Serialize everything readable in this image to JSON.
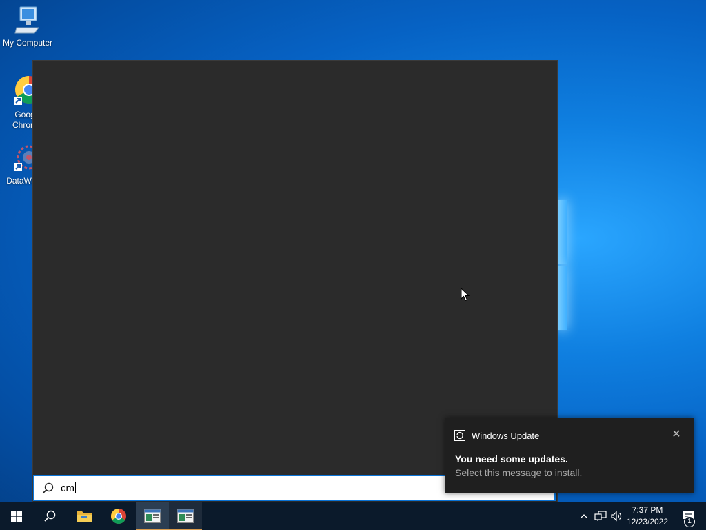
{
  "desktop": {
    "icons": [
      {
        "label": "My Computer",
        "icon": "computer-icon"
      },
      {
        "label": "Goog\nChrom",
        "label_line1": "Goog",
        "label_line2": "Chrom",
        "icon": "chrome-icon"
      },
      {
        "label_line1": "DataWag",
        "icon": "datawag-icon"
      }
    ]
  },
  "search": {
    "query": "cm",
    "icon": "search-icon"
  },
  "toast": {
    "app_name": "Windows Update",
    "title": "You need some updates.",
    "body": "Select this message to install.",
    "close_glyph": "✕"
  },
  "taskbar": {
    "items": [
      {
        "name": "start",
        "icon": "windows-start-icon"
      },
      {
        "name": "search",
        "icon": "search-icon"
      },
      {
        "name": "file-explorer",
        "icon": "folder-icon"
      },
      {
        "name": "chrome",
        "icon": "chrome-icon"
      },
      {
        "name": "app-1",
        "icon": "app-window-icon",
        "state": "active"
      },
      {
        "name": "app-2",
        "icon": "app-window-icon",
        "state": "running"
      }
    ],
    "tray": {
      "chevron": "^",
      "time": "7:37 PM",
      "date": "12/23/2022",
      "notification_count": "1"
    }
  },
  "colors": {
    "accent": "#0a74d8",
    "taskbar": "#0b1a2b",
    "search_panel": "#2b2b2b",
    "toast_bg": "#1f1f1f"
  }
}
